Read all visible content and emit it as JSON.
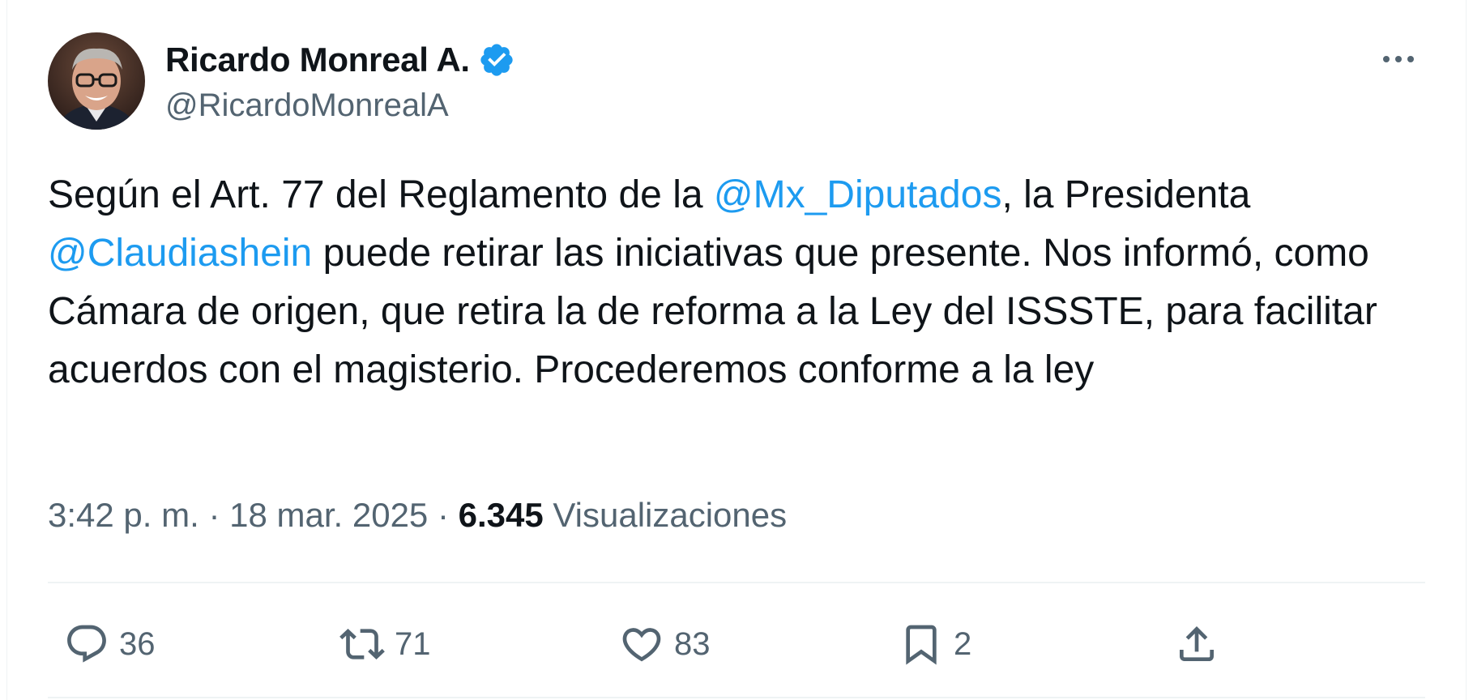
{
  "author": {
    "display_name": "Ricardo Monreal A.",
    "handle": "@RicardoMonrealA",
    "verified": true
  },
  "tweet": {
    "segments": [
      {
        "type": "text",
        "text": "Según el Art. 77 del Reglamento de la "
      },
      {
        "type": "mention",
        "text": "@Mx_Diputados"
      },
      {
        "type": "text",
        "text": ", la Presidenta "
      },
      {
        "type": "mention",
        "text": "@Claudiashein"
      },
      {
        "type": "text",
        "text": " puede retirar las iniciativas que presente. Nos informó, como Cámara de origen, que retira la de reforma a la Ley del ISSSTE, para facilitar acuerdos con el magisterio. Procederemos conforme a la ley"
      }
    ]
  },
  "meta": {
    "time": "3:42 p. m.",
    "separator": "·",
    "date": "18 mar. 2025",
    "views_count": "6.345",
    "views_label": "Visualizaciones"
  },
  "actions": {
    "replies": "36",
    "reposts": "71",
    "likes": "83",
    "bookmarks": "2"
  },
  "icons": {
    "verified": "verified-badge-icon",
    "more": "more-horizontal-icon",
    "reply": "reply-bubble-icon",
    "repost": "repost-arrows-icon",
    "like": "heart-icon",
    "bookmark": "bookmark-icon",
    "share": "share-upload-icon"
  },
  "colors": {
    "text": "#0f1419",
    "secondary": "#536471",
    "accent": "#1d9bf0",
    "divider": "#eff3f4"
  }
}
